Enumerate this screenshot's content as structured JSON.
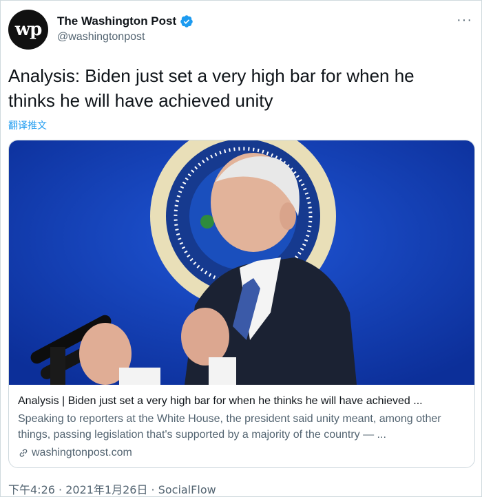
{
  "header": {
    "account_name": "The Washington Post",
    "handle": "@washingtonpost",
    "avatar_text": "wp",
    "more_label": "···"
  },
  "tweet": {
    "text": "Analysis: Biden just set a very high bar for when he thinks he will have achieved unity",
    "translate_label": "翻译推文"
  },
  "card": {
    "title": "Analysis | Biden just set a very high bar for when he thinks he will have achieved ...",
    "description": "Speaking to reporters at the White House, the president said unity meant, among other things, passing legislation that's supported by a majority of the country — ...",
    "domain": "washingtonpost.com"
  },
  "footer": {
    "time": "下午4:26",
    "separator": " · ",
    "date": "2021年1月26日",
    "source": "SocialFlow"
  },
  "colors": {
    "link_blue": "#1d9bf0",
    "secondary_text": "#536471",
    "border": "#cfd9de",
    "image_background": "#0f3aa8"
  },
  "icons": {
    "verified": "verified-badge-icon",
    "link": "link-icon",
    "more": "more-icon"
  }
}
